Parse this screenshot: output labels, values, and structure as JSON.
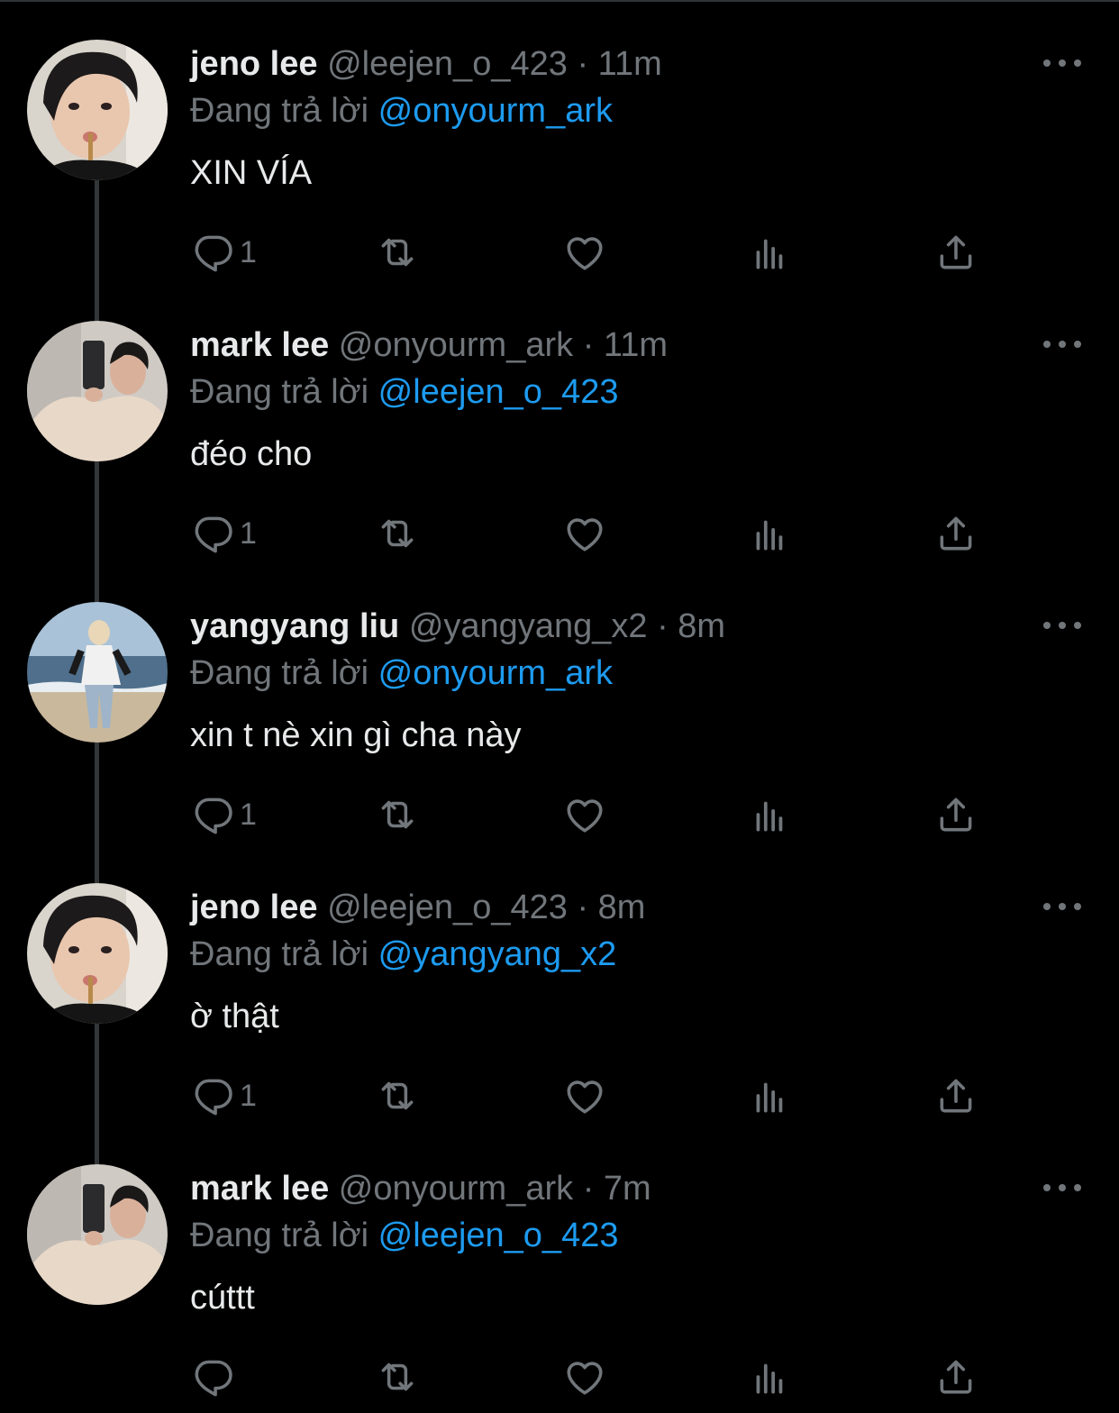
{
  "colors": {
    "background": "#000000",
    "text": "#e7e9ea",
    "muted": "#71767b",
    "mention": "#1d9bf0",
    "thread_line": "#333639"
  },
  "replying_label": "Đang trả lời",
  "tweets": [
    {
      "name": "jeno lee",
      "handle": "@leejen_o_423",
      "dot": "·",
      "time": "11m",
      "replying_to": "@onyourm_ark",
      "text": "XIN VÍA",
      "reply_count": "1",
      "avatar": "jeno-avatar"
    },
    {
      "name": "mark lee",
      "handle": "@onyourm_ark",
      "dot": "·",
      "time": "11m",
      "replying_to": "@leejen_o_423",
      "text": "đéo cho",
      "reply_count": "1",
      "avatar": "mark-avatar"
    },
    {
      "name": "yangyang liu",
      "handle": "@yangyang_x2",
      "dot": "·",
      "time": "8m",
      "replying_to": "@onyourm_ark",
      "text": "xin t nè xin gì cha này",
      "reply_count": "1",
      "avatar": "yangyang-avatar"
    },
    {
      "name": "jeno lee",
      "handle": "@leejen_o_423",
      "dot": "·",
      "time": "8m",
      "replying_to": "@yangyang_x2",
      "text": "ờ thật",
      "reply_count": "1",
      "avatar": "jeno-avatar"
    },
    {
      "name": "mark lee",
      "handle": "@onyourm_ark",
      "dot": "·",
      "time": "7m",
      "replying_to": "@leejen_o_423",
      "text": "cúttt",
      "reply_count": "",
      "avatar": "mark-avatar"
    }
  ],
  "icons": [
    "reply-icon",
    "retweet-icon",
    "like-icon",
    "views-icon",
    "share-icon",
    "more-icon"
  ]
}
